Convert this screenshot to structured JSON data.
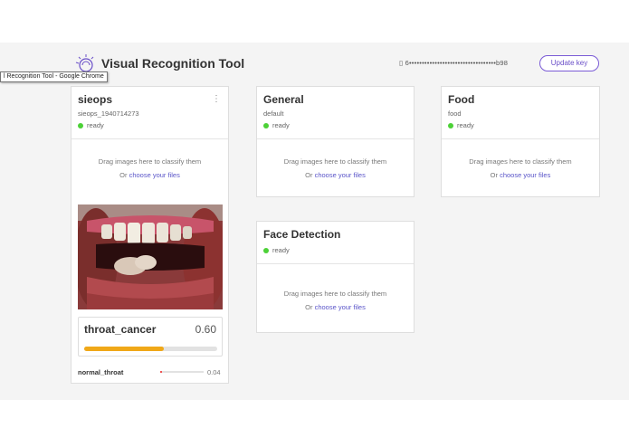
{
  "tooltip": "l Recognition Tool - Google Chrome",
  "header": {
    "title": "Visual Recognition Tool",
    "api_key": "▯ 6••••••••••••••••••••••••••••••••••b98",
    "update_label": "Update key"
  },
  "classifiers": [
    {
      "name": "sieops",
      "id": "sieops_1940714273",
      "status": "ready",
      "menu": "⋮",
      "drop_text": "Drag images here to classify them",
      "drop_or": "Or ",
      "drop_link": "choose your files",
      "result": {
        "top_class": "throat_cancer",
        "top_score": "0.60",
        "top_score_value": 0.6,
        "second_class": "normal_throat",
        "second_score": "0.04",
        "second_score_value": 0.04
      }
    },
    {
      "name": "General",
      "id": "default",
      "status": "ready",
      "drop_text": "Drag images here to classify them",
      "drop_or": "Or ",
      "drop_link": "choose your files"
    },
    {
      "name": "Food",
      "id": "food",
      "status": "ready",
      "drop_text": "Drag images here to classify them",
      "drop_or": "Or ",
      "drop_link": "choose your files"
    },
    {
      "name": "Face Detection",
      "status": "ready",
      "drop_text": "Drag images here to classify them",
      "drop_or": "Or ",
      "drop_link": "choose your files"
    }
  ],
  "colors": {
    "accent": "#6a4fc8",
    "status_ready": "#4cd137",
    "bar_primary": "#f0a818",
    "bar_secondary": "#e55555"
  }
}
